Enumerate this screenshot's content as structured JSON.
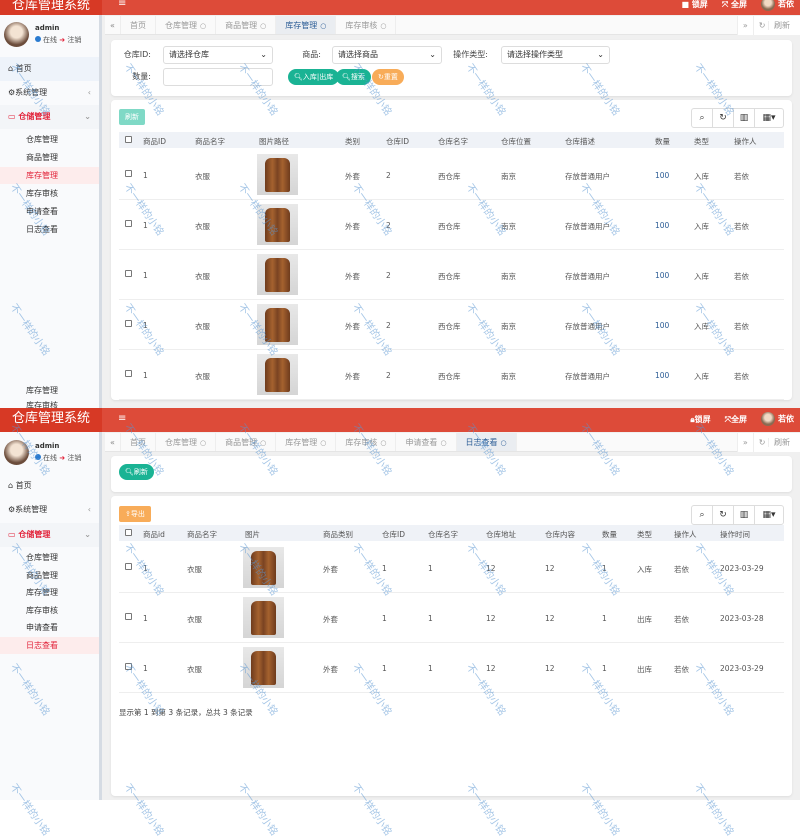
{
  "app_title": "仓库管理系统",
  "header": {
    "lock": "锁屏",
    "fullscreen": "全屏",
    "user": "若依"
  },
  "user": {
    "name": "admin",
    "status": "在线",
    "logout": "注销"
  },
  "sidebar": {
    "home": "首页",
    "system": "系统管理",
    "storage": "仓储管理",
    "items": [
      "仓库管理",
      "商品管理",
      "库存管理",
      "库存审核",
      "申请查看",
      "日志查看"
    ]
  },
  "tabs_right": {
    "refresh": "刷新"
  },
  "top": {
    "tabs": [
      "首页",
      "仓库管理",
      "商品管理",
      "库存管理",
      "库存审核"
    ],
    "active_tab": "库存管理",
    "search": {
      "warehouse_label": "仓库ID:",
      "warehouse_value": "请选择仓库",
      "goods_label": "商品:",
      "goods_value": "请选择商品",
      "optype_label": "操作类型:",
      "optype_value": "请选择操作类型",
      "qty_label": "数量:",
      "qty_value": "",
      "inout_btn": "入库|出库",
      "search_btn": "搜索",
      "reset_btn": "重置"
    },
    "refresh_btn": "刷新",
    "columns": [
      "商品ID",
      "商品名字",
      "图片路径",
      "类别",
      "仓库ID",
      "仓库名字",
      "仓库位置",
      "仓库描述",
      "数量",
      "类型",
      "操作人"
    ],
    "rows": [
      [
        "1",
        "衣服",
        "",
        "外套",
        "2",
        "西仓库",
        "南京",
        "存放普通用户",
        "100",
        "入库",
        "若依"
      ],
      [
        "1",
        "衣服",
        "",
        "外套",
        "2",
        "西仓库",
        "南京",
        "存放普通用户",
        "100",
        "入库",
        "若依"
      ],
      [
        "1",
        "衣服",
        "",
        "外套",
        "2",
        "西仓库",
        "南京",
        "存放普通用户",
        "100",
        "入库",
        "若依"
      ],
      [
        "1",
        "衣服",
        "",
        "外套",
        "2",
        "西仓库",
        "南京",
        "存放普通用户",
        "100",
        "入库",
        "若依"
      ],
      [
        "1",
        "衣服",
        "",
        "外套",
        "2",
        "西仓库",
        "南京",
        "存放普通用户",
        "100",
        "入库",
        "若依"
      ]
    ],
    "sidebar_bottom": [
      "库存管理",
      "库存审核"
    ]
  },
  "bottom": {
    "tabs": [
      "首页",
      "仓库管理",
      "商品管理",
      "库存管理",
      "库存审核",
      "申请查看",
      "日志查看"
    ],
    "active_tab": "日志查看",
    "refresh_btn": "刷新",
    "export_btn": "导出",
    "columns": [
      "商品id",
      "商品名字",
      "图片",
      "商品类别",
      "仓库ID",
      "仓库名字",
      "仓库地址",
      "仓库内容",
      "数量",
      "类型",
      "操作人",
      "操作时间"
    ],
    "rows": [
      [
        "1",
        "衣服",
        "",
        "外套",
        "1",
        "1",
        "12",
        "12",
        "1",
        "入库",
        "若依",
        "2023-03-29"
      ],
      [
        "1",
        "衣服",
        "",
        "外套",
        "1",
        "1",
        "12",
        "12",
        "1",
        "出库",
        "若依",
        "2023-03-28"
      ],
      [
        "1",
        "衣服",
        "",
        "外套",
        "1",
        "1",
        "12",
        "12",
        "1",
        "出库",
        "若依",
        "2023-03-29"
      ]
    ],
    "footer": "显示第 1 到第 3 条记录，总共 3 条记录"
  },
  "watermark": "不一样的小铭",
  "colors": {
    "header": "#dd4b39",
    "active": "#e2233a",
    "green": "#1ab394",
    "orange": "#f8ac59"
  }
}
